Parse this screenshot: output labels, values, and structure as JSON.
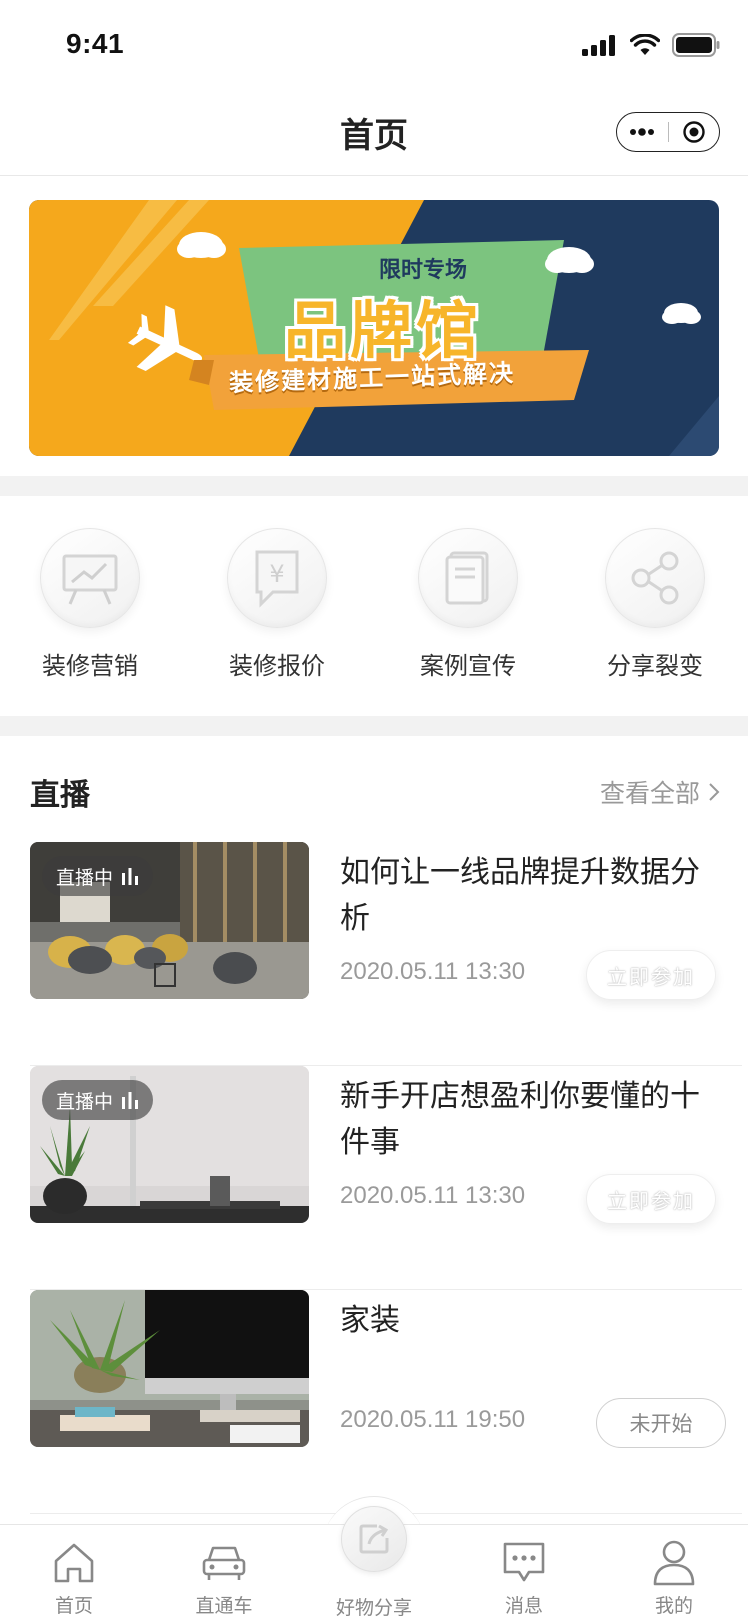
{
  "status_bar": {
    "time": "9:41"
  },
  "nav": {
    "title": "首页"
  },
  "banner": {
    "tag": "限时专场",
    "headline": "品牌馆",
    "slogan": "装修建材施工一站式解决",
    "colors": {
      "orange": "#F5A81C",
      "navy": "#1F3A5E",
      "green": "#7CC47F"
    }
  },
  "quick_menu": [
    {
      "label": "装修营销",
      "icon": "presentation-chart-icon"
    },
    {
      "label": "装修报价",
      "icon": "yen-document-icon"
    },
    {
      "label": "案例宣传",
      "icon": "book-icon"
    },
    {
      "label": "分享裂变",
      "icon": "share-icon"
    }
  ],
  "live": {
    "title": "直播",
    "view_all": "查看全部",
    "items": [
      {
        "title": "如何让一线品牌提升数据分析",
        "time": "2020.05.11 13:30",
        "badge": "直播中",
        "action": "立即参加"
      },
      {
        "title": "新手开店想盈利你要懂的十件事",
        "time": "2020.05.11 13:30",
        "badge": "直播中",
        "action": "立即参加"
      },
      {
        "title": "家装",
        "time": "2020.05.11 19:50",
        "badge": "",
        "action": "未开始"
      }
    ]
  },
  "tab_bar": [
    {
      "label": "首页",
      "icon": "home-icon"
    },
    {
      "label": "直通车",
      "icon": "car-icon"
    },
    {
      "label": "好物分享",
      "icon": "share-box-icon"
    },
    {
      "label": "消息",
      "icon": "message-icon"
    },
    {
      "label": "我的",
      "icon": "user-icon"
    }
  ]
}
